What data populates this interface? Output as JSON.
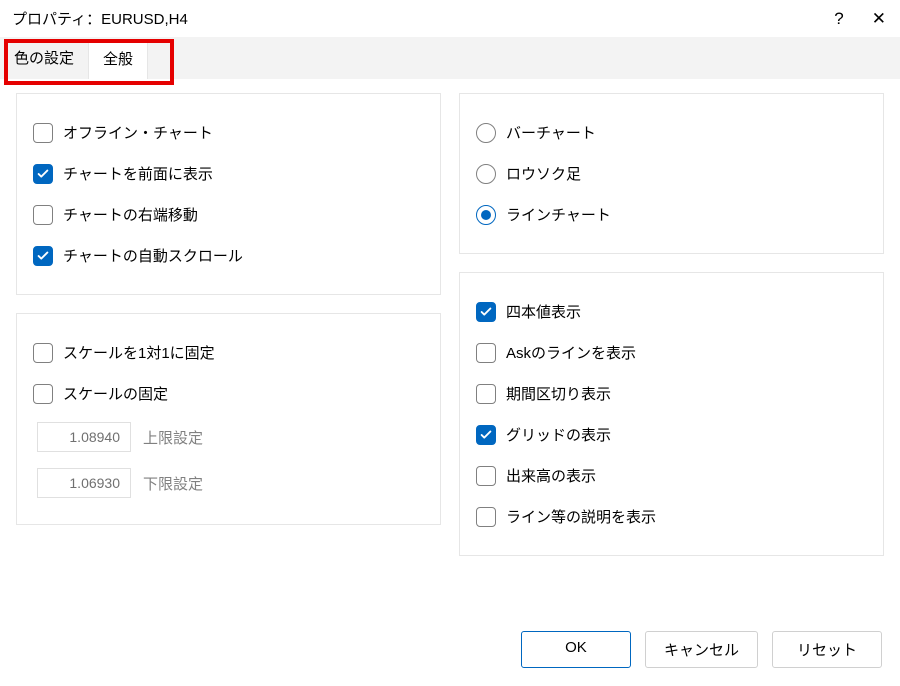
{
  "window": {
    "title": "プロパティ：EURUSD,H4"
  },
  "tabs": {
    "color": "色の設定",
    "general": "全般"
  },
  "left": {
    "offline_chart": "オフライン・チャート",
    "chart_on_foreground": "チャートを前面に表示",
    "chart_shift": "チャートの右端移動",
    "chart_autoscroll": "チャートの自動スクロール",
    "scale_fix_one_to_one": "スケールを1対1に固定",
    "scale_fix": "スケールの固定",
    "upper_value": "1.08940",
    "upper_label": "上限設定",
    "lower_value": "1.06930",
    "lower_label": "下限設定"
  },
  "right": {
    "bar_chart": "バーチャート",
    "candlesticks": "ロウソク足",
    "line_chart": "ラインチャート",
    "show_ohlc": "四本値表示",
    "show_ask_line": "Askのラインを表示",
    "show_period_sep": "期間区切り表示",
    "show_grid": "グリッドの表示",
    "show_volumes": "出来高の表示",
    "show_object_descr": "ライン等の説明を表示"
  },
  "buttons": {
    "ok": "OK",
    "cancel": "キャンセル",
    "reset": "リセット"
  }
}
